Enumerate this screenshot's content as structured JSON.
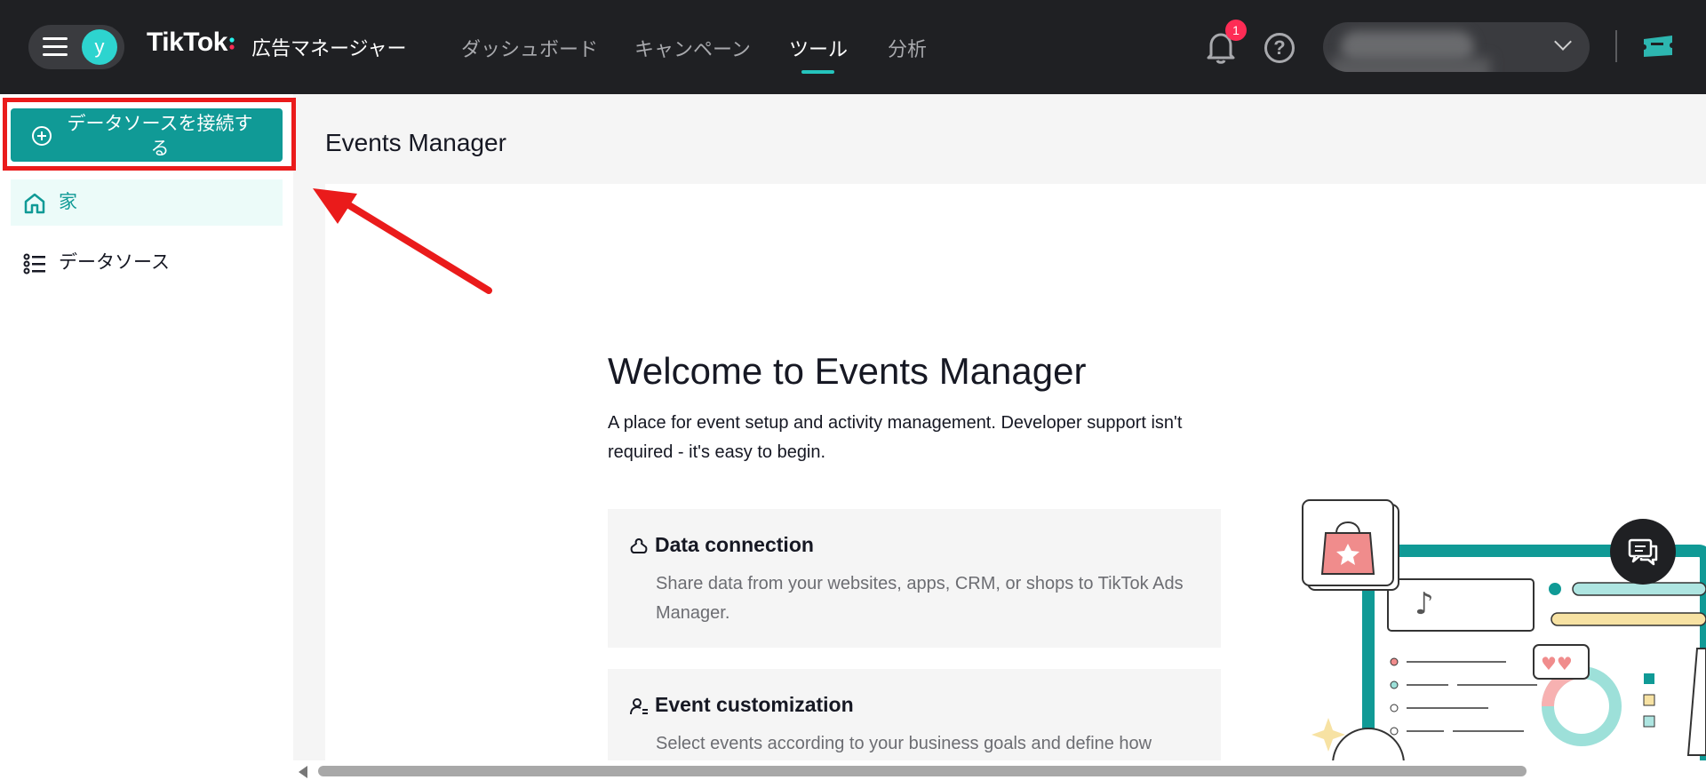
{
  "topbar": {
    "avatar_letter": "y",
    "logo_text": "TikTok",
    "logo_subtitle": "広告マネージャー",
    "nav": [
      {
        "label": "ダッシュボード"
      },
      {
        "label": "キャンペーン"
      },
      {
        "label": "ツール",
        "active": true
      },
      {
        "label": "分析"
      }
    ],
    "notification_count": "1",
    "help_symbol": "?"
  },
  "sidebar": {
    "connect_button_label": "データソースを接続する",
    "items": [
      {
        "label": "家",
        "icon": "home-icon",
        "active": true
      },
      {
        "label": "データソース",
        "icon": "list-icon",
        "active": false
      }
    ]
  },
  "main": {
    "page_title": "Events Manager",
    "welcome_title": "Welcome to Events Manager",
    "welcome_subtitle": "A place for event setup and activity management. Developer support isn't required - it's easy to begin.",
    "features": [
      {
        "title": "Data connection",
        "icon": "data-connection-icon",
        "description": "Share data from your websites, apps, CRM, or shops to TikTok Ads Manager."
      },
      {
        "title": "Event customization",
        "icon": "person-settings-icon",
        "description": "Select events according to your business goals and define how"
      }
    ]
  },
  "colors": {
    "accent": "#109a96",
    "topbar": "#1f2023",
    "highlight": "#ea1b1b",
    "badge": "#fe2c55"
  }
}
